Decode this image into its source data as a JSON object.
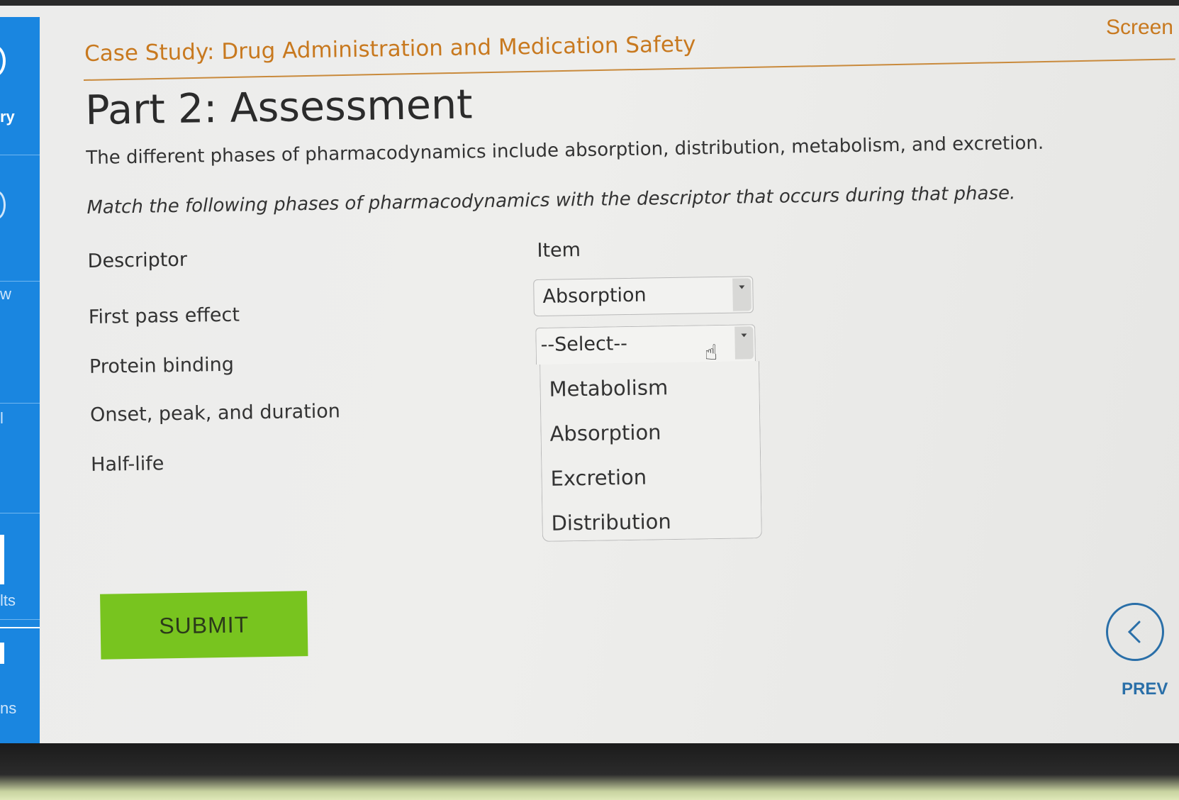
{
  "window": {
    "screen_label": "Screen"
  },
  "sidebar": {
    "items": [
      {
        "label": "ry"
      },
      {
        "label": ""
      },
      {
        "label": "w"
      },
      {
        "label": "l"
      },
      {
        "label": ""
      },
      {
        "label": "lts"
      },
      {
        "label": "ns"
      }
    ]
  },
  "header": {
    "case_title": "Case Study: Drug Administration and Medication Safety",
    "part_title": "Part 2: Assessment"
  },
  "main": {
    "intro": "The different phases of pharmacodynamics include absorption, distribution, metabolism, and excretion.",
    "instruction": "Match the following phases of pharmacodynamics with the descriptor that occurs during that phase.",
    "columns": {
      "descriptor": "Descriptor",
      "item": "Item"
    },
    "rows": [
      {
        "descriptor": "First pass effect",
        "selected": "Absorption"
      },
      {
        "descriptor": "Protein binding",
        "selected": "--Select--"
      },
      {
        "descriptor": "Onset, peak, and duration",
        "selected": ""
      },
      {
        "descriptor": "Half-life",
        "selected": ""
      }
    ],
    "dropdown_options": [
      "Metabolism",
      "Absorption",
      "Excretion",
      "Distribution"
    ],
    "submit_label": "SUBMIT"
  },
  "nav": {
    "prev_label": "PREV"
  },
  "colors": {
    "accent": "#c8791f",
    "submit": "#78c41f",
    "sidebar": "#1a86e0",
    "nav": "#2a6fa8"
  }
}
